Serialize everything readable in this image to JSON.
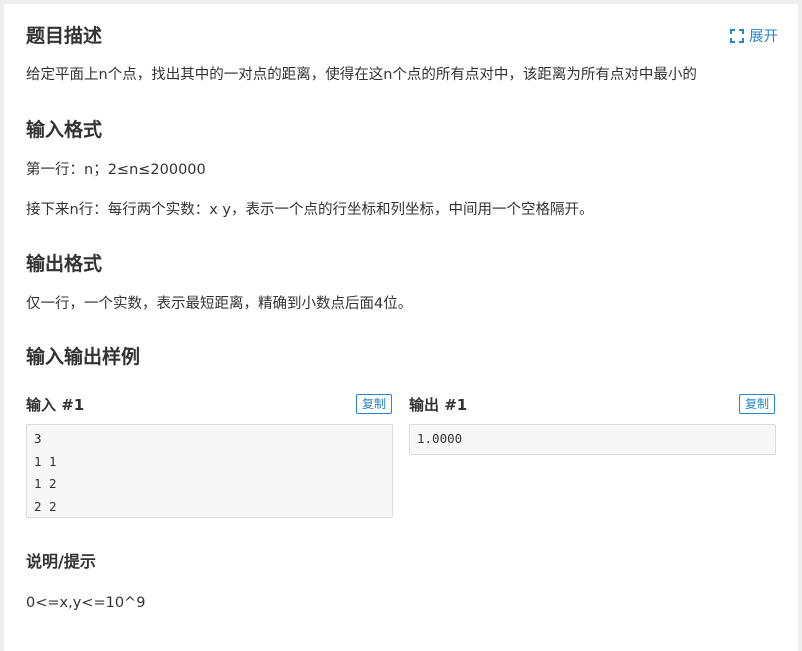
{
  "description": {
    "title": "题目描述",
    "expand_label": "展开",
    "expand_icon": "expand-icon",
    "text": "给定平面上n个点，找出其中的一对点的距离，使得在这n个点的所有点对中，该距离为所有点对中最小的"
  },
  "input_format": {
    "title": "输入格式",
    "lines": [
      "第一行：n；2≤n≤200000",
      "接下来n行：每行两个实数：x y，表示一个点的行坐标和列坐标，中间用一个空格隔开。"
    ]
  },
  "output_format": {
    "title": "输出格式",
    "text": "仅一行，一个实数，表示最短距离，精确到小数点后面4位。"
  },
  "samples": {
    "title": "输入输出样例",
    "input": {
      "title": "输入 #1",
      "copy_label": "复制",
      "lines": [
        "3",
        "1 1",
        "1 2",
        "2 2"
      ]
    },
    "output": {
      "title": "输出 #1",
      "copy_label": "复制",
      "lines": [
        "1.0000"
      ]
    }
  },
  "hint": {
    "title": "说明/提示",
    "text": "0<=x,y<=10^9"
  },
  "colors": {
    "accent": "#2a86c8",
    "code_bg": "#f7f7f7",
    "page_bg": "#efefef"
  }
}
